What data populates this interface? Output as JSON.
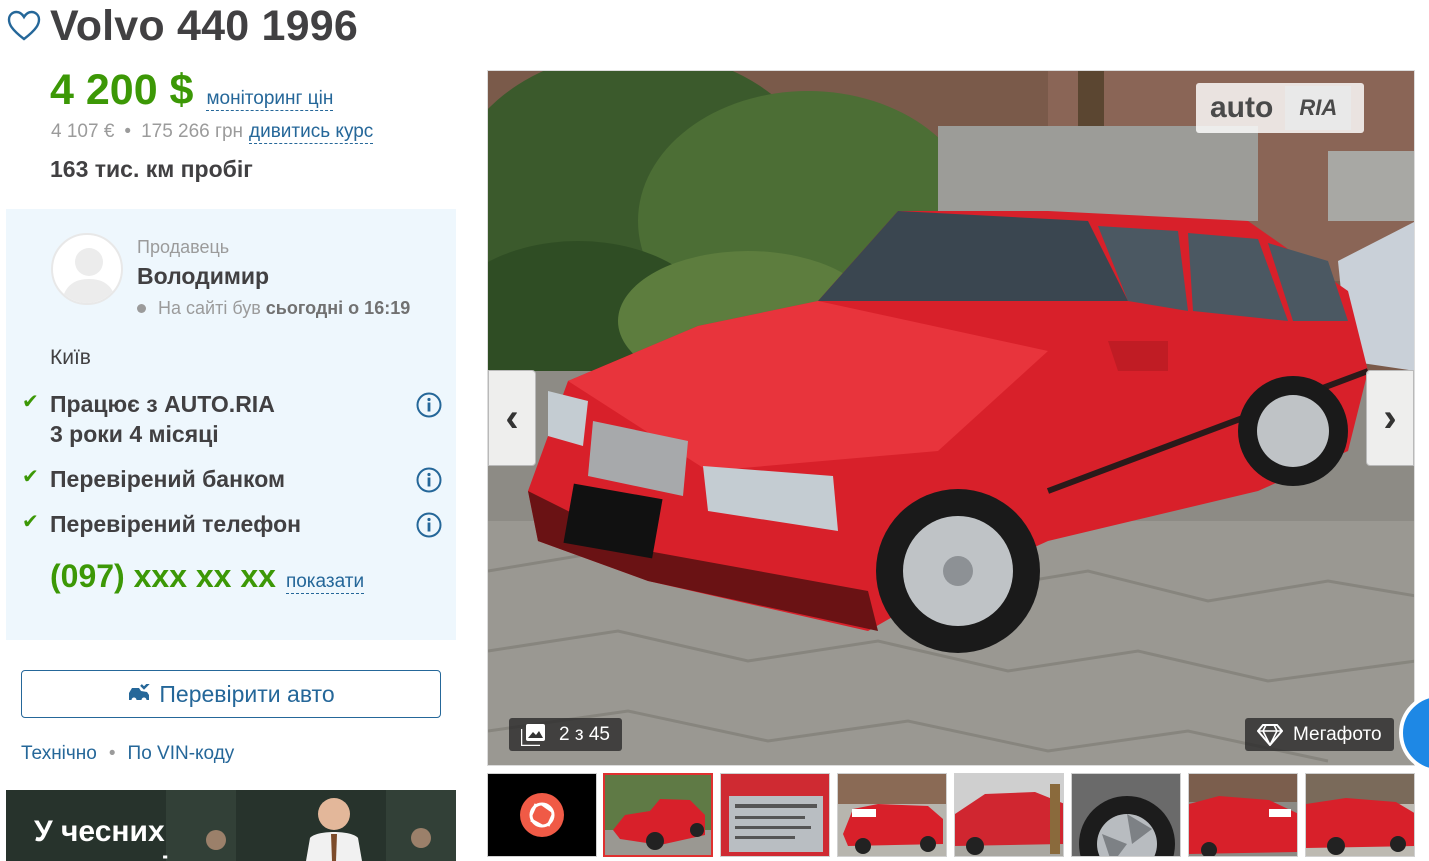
{
  "header": {
    "title": "Volvo 440 1996"
  },
  "price": {
    "main": "4 200 $",
    "monitor_link": "моніторинг цін",
    "eur": "4 107  €",
    "separator": "•",
    "uah": "175 266  грн",
    "rate_link": "дивитись курс"
  },
  "mileage": {
    "value": "163",
    "unit": "тис. км пробіг"
  },
  "seller": {
    "label": "Продавець",
    "name": "Володимир",
    "seen_prefix": "На сайті був",
    "seen_time": "сьогодні о 16:19",
    "city": "Київ",
    "features": [
      {
        "line1": "Працює з AUTO.RIA",
        "line2": "3 роки 4 місяці"
      },
      {
        "line1": "Перевірений банком"
      },
      {
        "line1": "Перевірений телефон"
      }
    ],
    "phone": "(097) xxx xx xx",
    "show_link": "показати"
  },
  "check": {
    "button_label": "Перевірити авто",
    "link_technical": "Технічно",
    "separator": "•",
    "link_vin": "По VIN-коду"
  },
  "ad": {
    "line1": "У чесних",
    "line2": "продавців"
  },
  "gallery": {
    "watermark_auto": "auto",
    "watermark_ria": "RIA",
    "counter": "2 з 45",
    "mega_label": "Мегафото",
    "prev_arrow": "‹",
    "next_arrow": "›"
  },
  "colors": {
    "price_green": "#3c9806",
    "link_blue": "#256799",
    "seller_bg": "#eef7fd",
    "car_red": "#d8202a"
  },
  "icons": [
    "heart-icon",
    "check-icon",
    "info-icon",
    "camera-shutter-icon",
    "photos-icon",
    "diamond-icon",
    "car-check-icon"
  ]
}
